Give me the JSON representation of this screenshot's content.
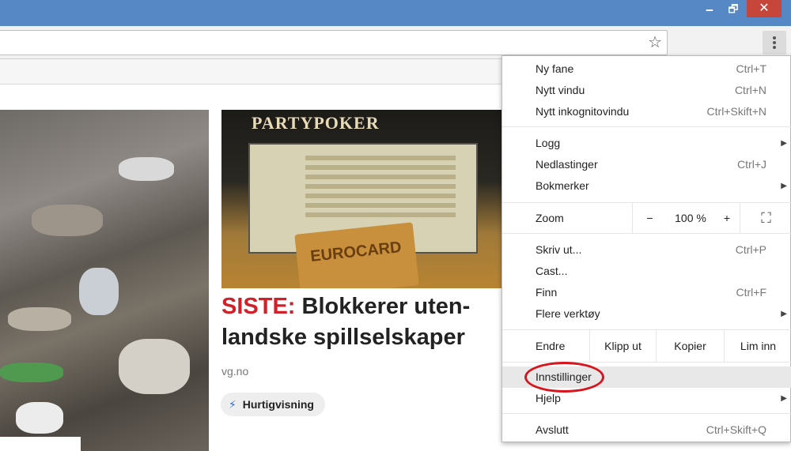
{
  "window": {
    "minimize_glyph": "🗕",
    "maximize_glyph": "🗗",
    "close_glyph": "✕"
  },
  "toolbar": {
    "star_icon": "☆"
  },
  "article": {
    "headline_prefix": "SISTE:",
    "headline_text": "Blokkerer uten­landske spill­selskaper",
    "source": "vg.no",
    "quick_view_icon": "⚡",
    "quick_view_label": "Hurtigvisning",
    "image_text_1": "PARTYPOKER",
    "image_text_2": "EUROCARD"
  },
  "menu": {
    "new_tab": {
      "label": "Ny fane",
      "shortcut": "Ctrl+T"
    },
    "new_window": {
      "label": "Nytt vindu",
      "shortcut": "Ctrl+N"
    },
    "incognito": {
      "label": "Nytt inkognitovindu",
      "shortcut": "Ctrl+Skift+N"
    },
    "history": {
      "label": "Logg"
    },
    "downloads": {
      "label": "Nedlastinger",
      "shortcut": "Ctrl+J"
    },
    "bookmarks": {
      "label": "Bokmerker"
    },
    "zoom": {
      "label": "Zoom",
      "minus": "−",
      "value": "100 %",
      "plus": "+",
      "fullscreen": "⛶"
    },
    "print": {
      "label": "Skriv ut...",
      "shortcut": "Ctrl+P"
    },
    "cast": {
      "label": "Cast..."
    },
    "find": {
      "label": "Finn",
      "shortcut": "Ctrl+F"
    },
    "more_tools": {
      "label": "Flere verktøy"
    },
    "edit": {
      "label": "Endre",
      "cut": "Klipp ut",
      "copy": "Kopier",
      "paste": "Lim inn"
    },
    "settings": {
      "label": "Innstillinger"
    },
    "help": {
      "label": "Hjelp"
    },
    "exit": {
      "label": "Avslutt",
      "shortcut": "Ctrl+Skift+Q"
    },
    "arrow_glyph": "▶"
  }
}
